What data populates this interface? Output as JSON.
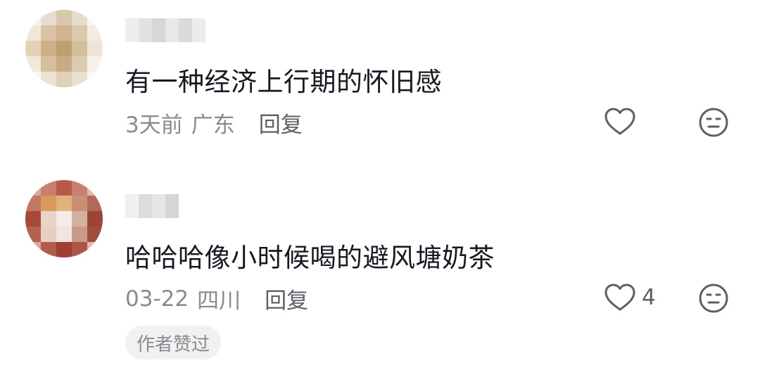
{
  "comments": [
    {
      "text": "有一种经济上行期的怀旧感",
      "time": "3天前",
      "location": "广东",
      "reply_label": "回复",
      "like_count": "",
      "avatar_colors": [
        "#f6f4ee",
        "#e8ddd0",
        "#d8c6ae",
        "#e6dccd",
        "#f7f5f0",
        "#efe6d8",
        "#d9c3a4",
        "#cfb48f",
        "#dcc8ab",
        "#f2ece3",
        "#e4d2b6",
        "#cbb088",
        "#bfa073",
        "#d5be9c",
        "#eee5d8",
        "#f0e8db",
        "#d6bf9d",
        "#c8ac85",
        "#dccbb0",
        "#f5f0e8",
        "#f8f6f2",
        "#ece3d6",
        "#e0d0ba",
        "#ebe1d3",
        "#faf8f5"
      ]
    },
    {
      "text": "哈哈哈像小时候喝的避风塘奶茶",
      "time": "03-22",
      "location": "四川",
      "reply_label": "回复",
      "like_count": "4",
      "author_badge": "作者赞过",
      "avatar_colors": [
        "#d9a79a",
        "#c97f6d",
        "#b85a46",
        "#c8816f",
        "#e2b9ad",
        "#c27864",
        "#d89a5a",
        "#e3b27a",
        "#c89070",
        "#b46a59",
        "#a8483a",
        "#e9d4c6",
        "#f4ece6",
        "#d3b1a0",
        "#9c4436",
        "#b5614f",
        "#e6cfc2",
        "#f1e6df",
        "#c99a86",
        "#a24c3e",
        "#d8aa9d",
        "#b35b4b",
        "#9e3f33",
        "#ad5647",
        "#e0bcb0"
      ]
    }
  ],
  "icons": {
    "like": "heart-outline-icon",
    "dislike": "neutral-face-icon"
  },
  "colors": {
    "text": "#161823",
    "meta": "#8a8b91",
    "icon": "#5e5f66",
    "badge_bg": "#f1f1f2"
  }
}
